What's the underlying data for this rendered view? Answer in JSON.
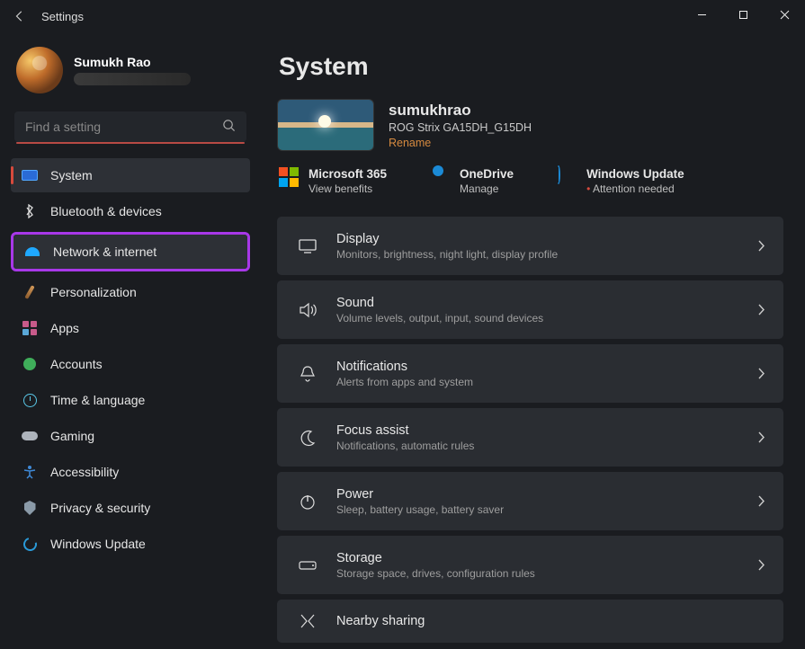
{
  "window": {
    "title": "Settings"
  },
  "user": {
    "name": "Sumukh Rao"
  },
  "search": {
    "placeholder": "Find a setting"
  },
  "sidebar": {
    "items": [
      {
        "label": "System"
      },
      {
        "label": "Bluetooth & devices"
      },
      {
        "label": "Network & internet"
      },
      {
        "label": "Personalization"
      },
      {
        "label": "Apps"
      },
      {
        "label": "Accounts"
      },
      {
        "label": "Time & language"
      },
      {
        "label": "Gaming"
      },
      {
        "label": "Accessibility"
      },
      {
        "label": "Privacy & security"
      },
      {
        "label": "Windows Update"
      }
    ]
  },
  "page": {
    "title": "System"
  },
  "device": {
    "name": "sumukhrao",
    "model": "ROG Strix GA15DH_G15DH",
    "rename": "Rename"
  },
  "services": {
    "ms365": {
      "title": "Microsoft 365",
      "sub": "View benefits"
    },
    "onedrive": {
      "title": "OneDrive",
      "sub": "Manage"
    },
    "update": {
      "title": "Windows Update",
      "sub": "Attention needed"
    }
  },
  "cards": [
    {
      "title": "Display",
      "sub": "Monitors, brightness, night light, display profile"
    },
    {
      "title": "Sound",
      "sub": "Volume levels, output, input, sound devices"
    },
    {
      "title": "Notifications",
      "sub": "Alerts from apps and system"
    },
    {
      "title": "Focus assist",
      "sub": "Notifications, automatic rules"
    },
    {
      "title": "Power",
      "sub": "Sleep, battery usage, battery saver"
    },
    {
      "title": "Storage",
      "sub": "Storage space, drives, configuration rules"
    },
    {
      "title": "Nearby sharing",
      "sub": ""
    }
  ]
}
